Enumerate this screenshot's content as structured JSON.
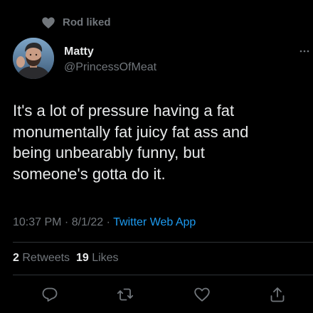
{
  "social_context": {
    "icon": "heart-icon",
    "text": "Rod liked"
  },
  "author": {
    "name": "Matty",
    "handle": "@PrincessOfMeat",
    "avatar": "avatar"
  },
  "tweet": {
    "lines": [
      "It's a lot of pressure having a fat",
      "monumentally fat juicy fat ass and",
      "being unbearably funny, but",
      "someone's gotta do it."
    ]
  },
  "meta": {
    "time": "10:37 PM",
    "separator": " · ",
    "date": "8/1/22",
    "source": "Twitter Web App"
  },
  "stats": {
    "retweets_count": "2",
    "retweets_label": "Retweets",
    "likes_count": "19",
    "likes_label": "Likes"
  },
  "actions": [
    {
      "icon": "reply-icon"
    },
    {
      "icon": "retweet-icon"
    },
    {
      "icon": "like-icon"
    },
    {
      "icon": "share-icon"
    }
  ],
  "colors": {
    "background": "#000000",
    "primary_text": "#e7e9ea",
    "secondary_text": "#71767b",
    "link": "#1d9bf0",
    "divider": "#2f3336"
  }
}
